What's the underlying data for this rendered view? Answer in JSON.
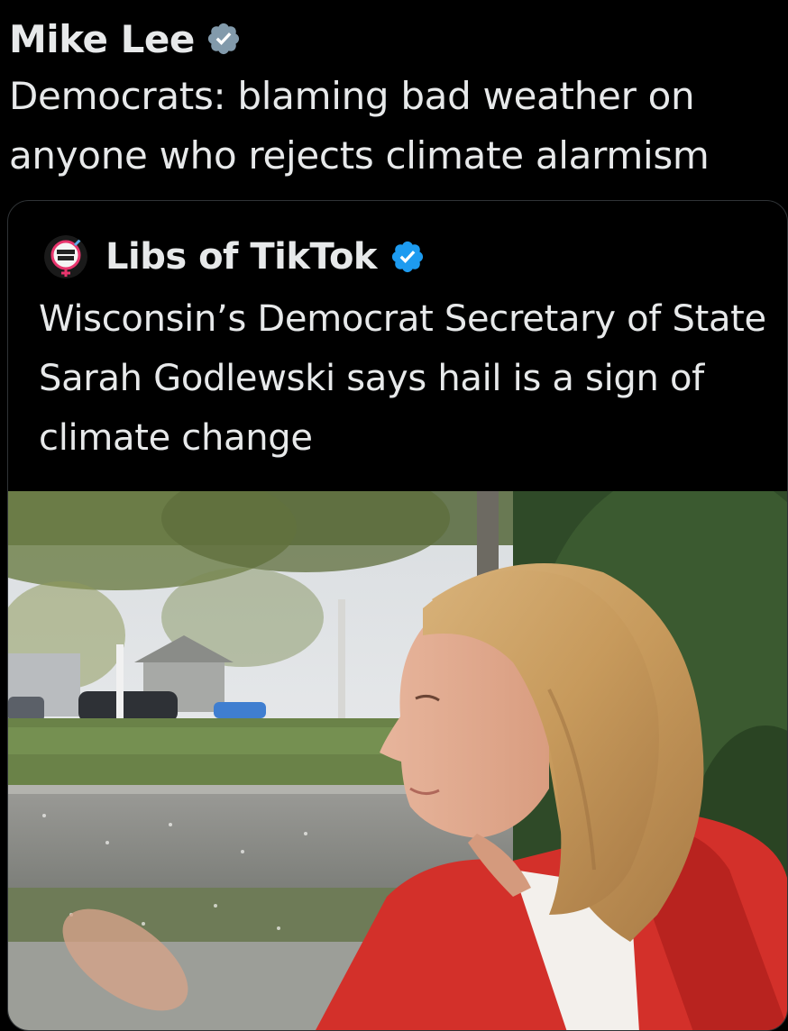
{
  "post": {
    "author_name": "Mike Lee",
    "verified_icon": "verified-badge-icon",
    "text": "Democrats: blaming bad weather on anyone who rejects climate alarmism"
  },
  "quoted_post": {
    "author_name": "Libs of TikTok",
    "avatar_icon": "libs-of-tiktok-avatar",
    "verified_icon": "verified-badge-icon",
    "text": "Wisconsin’s Democrat Secretary of State Sarah Godlewski says hail is a sign of climate change",
    "media": {
      "type": "video-thumbnail",
      "description_icon": "video-frame-image"
    }
  },
  "colors": {
    "background": "#000000",
    "text": "#e7e9ea",
    "border": "#2f3336",
    "verified_grey": "#829aab",
    "verified_blue": "#1d9bf0"
  }
}
